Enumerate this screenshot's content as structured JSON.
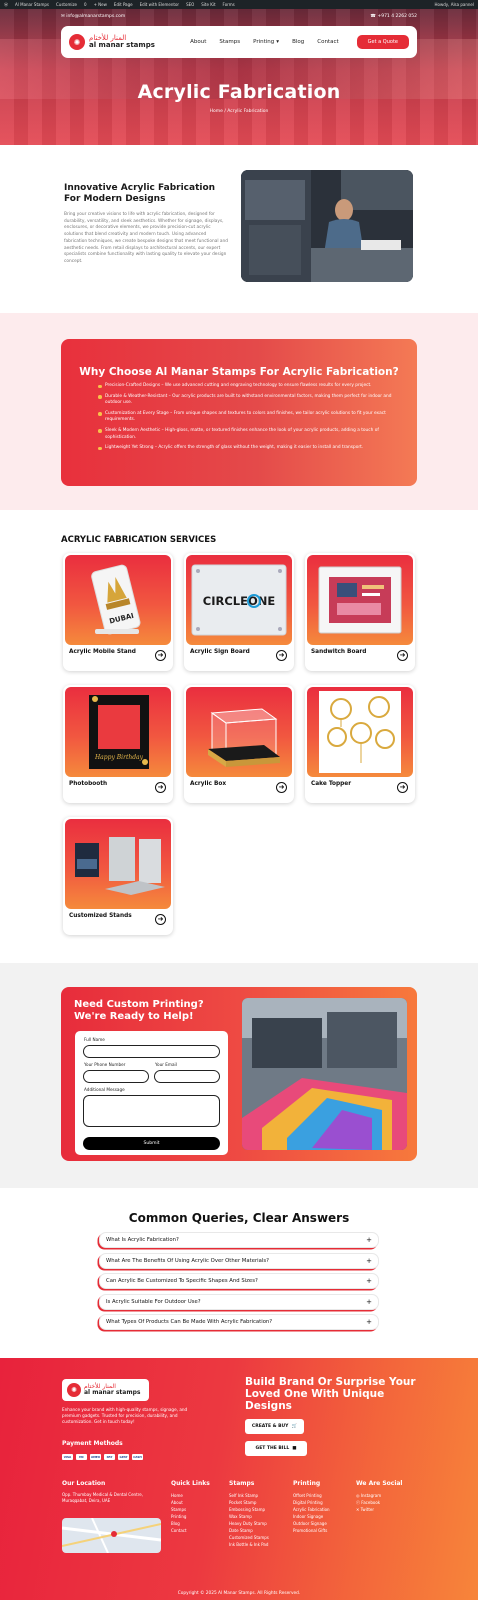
{
  "admin_bar": {
    "items": [
      "Al Manar Stamps",
      "Customize",
      "0",
      "+ New",
      "Edit Page",
      "Edit with Elementor",
      "SEO",
      "Site Kit",
      "Forms"
    ],
    "user": "Howdy, Alsa pannel"
  },
  "topbar": {
    "email": "info@almanarstamps.com",
    "phone": "+971 4 2262 052"
  },
  "brand": {
    "name_ar": "المنار للأختام",
    "name_en": "al manar stamps"
  },
  "nav": {
    "items": [
      "About",
      "Stamps",
      "Printing",
      "Blog",
      "Contact"
    ],
    "cta": "Get a Quote"
  },
  "hero": {
    "title": "Acrylic Fabrication",
    "breadcrumb": "Home / Acrylic Fabrication"
  },
  "intro": {
    "heading": "Innovative Acrylic Fabrication For Modern Designs",
    "body": "Bring your creative visions to life with acrylic fabrication, designed for durability, versatility, and sleek aesthetics. Whether for signage, displays, enclosures, or decorative elements, we provide precision-cut acrylic solutions that blend creativity and modern touch. Using advanced fabrication techniques, we create bespoke designs that meet functional and aesthetic needs. From retail displays to architectural accents, our expert specialists combine functionality with lasting quality to elevate your design concept."
  },
  "why": {
    "heading": "Why Choose Al Manar Stamps For Acrylic Fabrication?",
    "points": [
      "Precision-Crafted Designs – We use advanced cutting and engraving technology to ensure flawless results for every project.",
      "Durable & Weather-Resistant – Our acrylic products are built to withstand environmental factors, making them perfect for indoor and outdoor use.",
      "Customization at Every Stage – From unique shapes and textures to colors and finishes, we tailor acrylic solutions to fit your exact requirements.",
      "Sleek & Modern Aesthetic – High-gloss, matte, or textured finishes enhance the look of your acrylic products, adding a touch of sophistication.",
      "Lightweight Yet Strong – Acrylic offers the strength of glass without the weight, making it easier to install and transport."
    ]
  },
  "services": {
    "heading": "ACRYLIC FABRICATION SERVICES",
    "items": [
      {
        "label": "Acrylic Mobile Stand"
      },
      {
        "label": "Acrylic Sign Board",
        "image_text": "CIRCLEONE"
      },
      {
        "label": "Sandwitch Board"
      },
      {
        "label": "Photobooth",
        "image_text": "Happy Birthday"
      },
      {
        "label": "Acrylic Box"
      },
      {
        "label": "Cake Topper"
      },
      {
        "label": "Customized Stands"
      }
    ],
    "phone_sign_text": "DUBAI"
  },
  "contact_form": {
    "heading": "Need Custom Printing? We're Ready to Help!",
    "full_name_label": "Full Name",
    "phone_label": "Your Phone Number",
    "email_label": "Your Email",
    "message_label": "Additional Message",
    "submit": "Submit"
  },
  "faq": {
    "heading": "Common Queries, Clear Answers",
    "items": [
      "What Is Acrylic Fabrication?",
      "What Are The Benefits Of Using Acrylic Over Other Materials?",
      "Can Acrylic Be Customized To Specific Shapes And Sizes?",
      "Is Acrylic Suitable For Outdoor Use?",
      "What Types Of Products Can Be Made With Acrylic Fabrication?"
    ]
  },
  "footer": {
    "about": "Enhance your brand with high-quality stamps, signage, and premium gadgets. Trusted for precision, durability, and customization. Get in touch today!",
    "payment_heading": "Payment Methods",
    "payment_methods": [
      "VISA",
      "MC",
      "AMEX",
      "PAY",
      "GPAY",
      "CASH"
    ],
    "slogan": "Build Brand Or Surprise Your Loved One With Unique Designs",
    "buttons": [
      "CREATE & BUY",
      "GET THE BILL"
    ],
    "columns": [
      {
        "heading": "Our Location",
        "items": [
          "Opp. Thumbay Medical & Dental Centre, Muraqqabat, Deira, UAE"
        ]
      },
      {
        "heading": "Quick Links",
        "items": [
          "Home",
          "About",
          "Stamps",
          "Printing",
          "Blog",
          "Contact"
        ]
      },
      {
        "heading": "Stamps",
        "items": [
          "Self Ink Stamp",
          "Pocket Stamp",
          "Embossing Stamp",
          "Wax Stamp",
          "Heavy Duty Stamp",
          "Date Stamp",
          "Customized Stamps",
          "Ink Bottle & Ink Pad"
        ]
      },
      {
        "heading": "Printing",
        "items": [
          "Offset Printing",
          "Digital Printing",
          "Acrylic Fabrication",
          "Indoor Signage",
          "Outdoor Signage",
          "Promotional Gifts"
        ]
      },
      {
        "heading": "We Are Social",
        "items": [
          "Instagram",
          "Facebook",
          "Twitter"
        ]
      }
    ],
    "copyright": "Copyright © 2025 Al Manar Stamps. All Rights Reserved."
  }
}
